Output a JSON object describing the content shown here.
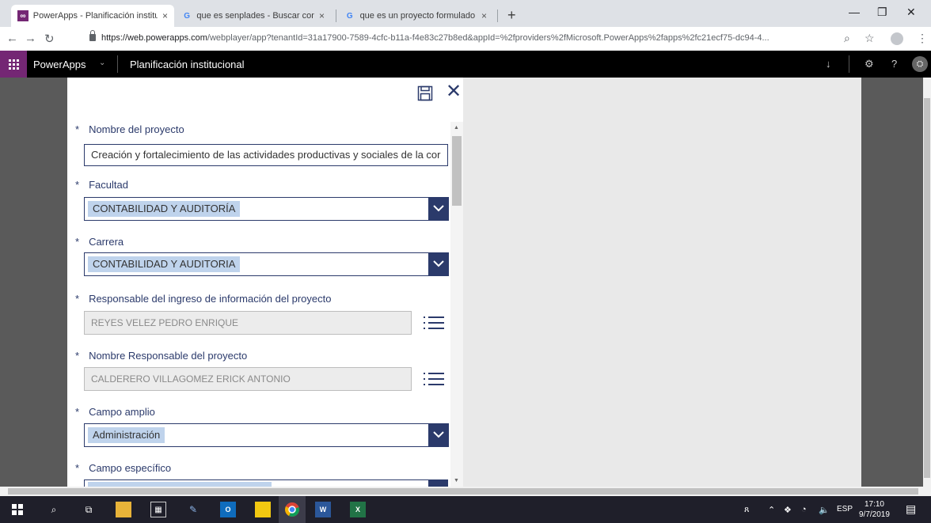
{
  "browser": {
    "tabs": [
      {
        "title": "PowerApps - Planificación institu",
        "close": "×"
      },
      {
        "title": "que es senplades - Buscar con Go",
        "close": "×"
      },
      {
        "title": "que es un proyecto formulado - ",
        "close": "×"
      }
    ],
    "new_tab": "+",
    "url_host": "https://web.powerapps.com",
    "url_path": "/webplayer/app?tenantId=31a17900-7589-4cfc-b11a-f4e83c27b8ed&appId=%2fproviders%2fMicrosoft.PowerApps%2fapps%2fc21ecf75-dc94-4..."
  },
  "appbar": {
    "app_name": "PowerApps",
    "title": "Planificación institucional"
  },
  "form": {
    "fields": [
      {
        "label": "Nombre del proyecto",
        "required": "*",
        "value": "Creación y fortalecimiento de las actividades productivas y sociales de la cor"
      },
      {
        "label": "Facultad",
        "required": "*",
        "value": "CONTABILIDAD Y AUDITORÍA"
      },
      {
        "label": "Carrera",
        "required": "*",
        "value": "CONTABILIDAD Y AUDITORIA"
      },
      {
        "label": "Responsable del ingreso de información del proyecto",
        "required": "*",
        "value": "REYES VELEZ PEDRO ENRIQUE"
      },
      {
        "label": "Nombre Responsable del proyecto",
        "required": "*",
        "value": "CALDERERO VILLAGOMEZ  ERICK ANTONIO"
      },
      {
        "label": "Campo amplio",
        "required": "*",
        "value": "Administración"
      },
      {
        "label": "Campo específico",
        "required": "*",
        "value": ""
      }
    ]
  },
  "taskbar": {
    "lang": "ESP",
    "time": "17:10",
    "date": "9/7/2019",
    "notifications": "5"
  },
  "colors": {
    "accent": "#2b3a6b",
    "brand": "#742774",
    "selection": "#bfd3ec"
  }
}
